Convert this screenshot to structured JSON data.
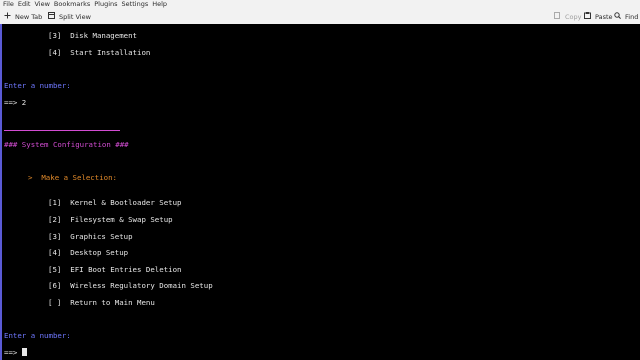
{
  "menubar": {
    "items": [
      "File",
      "Edit",
      "View",
      "Bookmarks",
      "Plugins",
      "Settings",
      "Help"
    ]
  },
  "toolbar": {
    "new_tab": {
      "label": "New Tab",
      "icon": "plus-icon"
    },
    "split_view": {
      "label": "Split View",
      "icon": "split-view-icon"
    },
    "copy": {
      "label": "Copy",
      "icon": "copy-icon",
      "enabled": false
    },
    "paste": {
      "label": "Paste",
      "icon": "paste-icon"
    },
    "find": {
      "label": "Find",
      "icon": "search-icon"
    }
  },
  "terminal": {
    "prev_menu": [
      {
        "num": "[3]",
        "label": "Disk Management"
      },
      {
        "num": "[4]",
        "label": "Start Installation"
      }
    ],
    "prompt1": "Enter a number:",
    "input1": "==> 2",
    "section_title": "### System Configuration ###",
    "selection_prompt": ">  Make a Selection:",
    "options": [
      {
        "num": "[1]",
        "label": "Kernel & Bootloader Setup"
      },
      {
        "num": "[2]",
        "label": "Filesystem & Swap Setup"
      },
      {
        "num": "[3]",
        "label": "Graphics Setup"
      },
      {
        "num": "[4]",
        "label": "Desktop Setup"
      },
      {
        "num": "[5]",
        "label": "EFI Boot Entries Deletion"
      },
      {
        "num": "[6]",
        "label": "Wireless Regulatory Domain Setup"
      },
      {
        "num": "[ ]",
        "label": "Return to Main Menu"
      }
    ],
    "prompt2": "Enter a number:",
    "input_prefix": "==> ",
    "colors": {
      "prompt": "#6f78ff",
      "title": "#d24cd2",
      "selection": "#e0892a"
    }
  }
}
